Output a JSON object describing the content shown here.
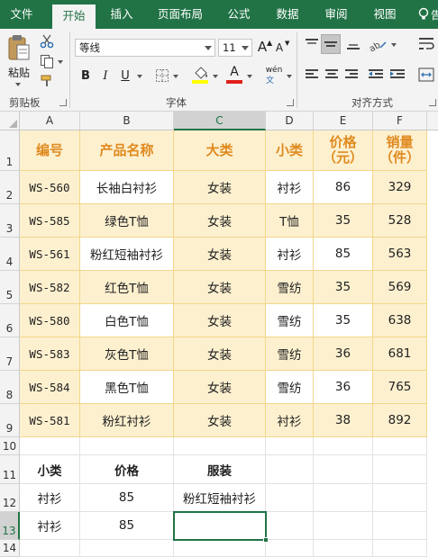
{
  "ribbon": {
    "tabs": [
      "文件",
      "开始",
      "插入",
      "页面布局",
      "公式",
      "数据",
      "审阅",
      "视图"
    ],
    "active_tab": "开始",
    "help_text": "告",
    "clipboard": {
      "paste_label": "粘贴",
      "group_label": "剪贴板"
    },
    "font": {
      "name": "等线",
      "size": "11",
      "grow_label": "A",
      "shrink_label": "A",
      "bold_label": "B",
      "italic_label": "I",
      "underline_label": "U",
      "font_color_label": "A",
      "phonetic_label": "wén",
      "group_label": "字体",
      "fill_color": "#ffff00",
      "font_color": "#e0201b"
    },
    "alignment": {
      "group_label": "对齐方式"
    }
  },
  "columns": [
    "A",
    "B",
    "C",
    "D",
    "E",
    "F"
  ],
  "rows": [
    "1",
    "2",
    "3",
    "4",
    "5",
    "6",
    "7",
    "8",
    "9",
    "10",
    "11",
    "12",
    "13",
    "14"
  ],
  "selected_cell": "C13",
  "table": {
    "headers": [
      "编号",
      "产品名称",
      "大类",
      "小类",
      "价格（元）",
      "销量（件）"
    ],
    "rows": [
      [
        "WS-560",
        "长袖白衬衫",
        "女装",
        "衬衫",
        "86",
        "329"
      ],
      [
        "WS-585",
        "绿色T恤",
        "女装",
        "T恤",
        "35",
        "528"
      ],
      [
        "WS-561",
        "粉红短袖衬衫",
        "女装",
        "衬衫",
        "85",
        "563"
      ],
      [
        "WS-582",
        "红色T恤",
        "女装",
        "雪纺",
        "35",
        "569"
      ],
      [
        "WS-580",
        "白色T恤",
        "女装",
        "雪纺",
        "35",
        "638"
      ],
      [
        "WS-583",
        "灰色T恤",
        "女装",
        "雪纺",
        "36",
        "681"
      ],
      [
        "WS-584",
        "黑色T恤",
        "女装",
        "雪纺",
        "36",
        "765"
      ],
      [
        "WS-581",
        "粉红衬衫",
        "女装",
        "衬衫",
        "38",
        "892"
      ]
    ]
  },
  "lookup": {
    "headers": [
      "小类",
      "价格",
      "服装"
    ],
    "rows": [
      [
        "衬衫",
        "85",
        "粉红短袖衬衫"
      ],
      [
        "衬衫",
        "85",
        ""
      ]
    ]
  },
  "colors": {
    "excel_green": "#217346",
    "header_text": "#e08a20",
    "table_cream": "#fdf0cf",
    "table_border": "#f2d68a"
  }
}
